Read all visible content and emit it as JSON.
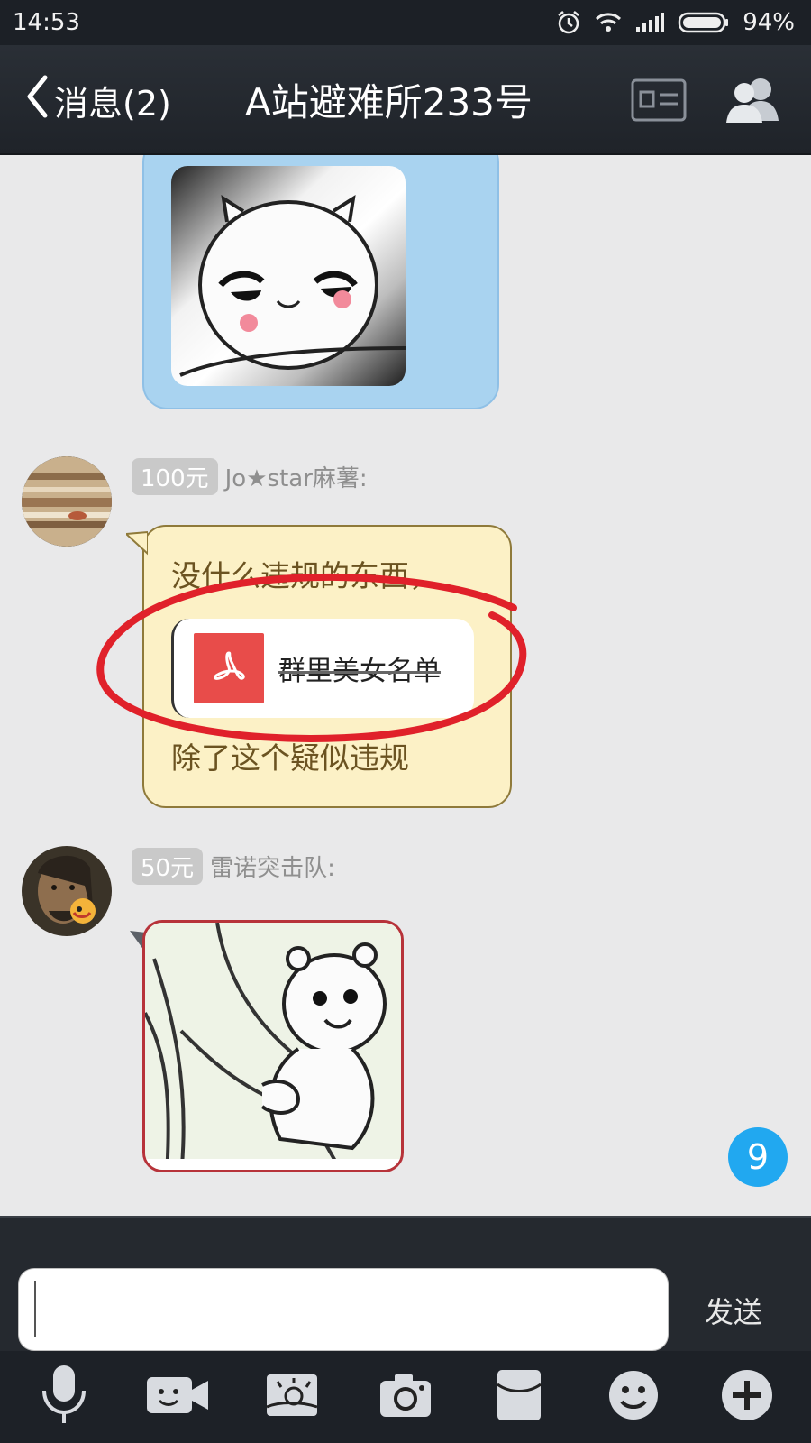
{
  "status_bar": {
    "time": "14:53",
    "battery": "94%",
    "icons": [
      "alarm-icon",
      "wifi-icon",
      "signal-icon",
      "battery-icon"
    ]
  },
  "header": {
    "back_label": "消息(2)",
    "title": "A站避难所233号",
    "icons": [
      "profile-card-icon",
      "group-members-icon"
    ]
  },
  "messages": [
    {
      "type": "sticker",
      "bubble_color": "#a9d3f0"
    },
    {
      "type": "text_with_file",
      "badge": "100元",
      "sender": "Jo★star麻薯:",
      "line1": "没什么违规的东西，",
      "file_name": "群里美女名单",
      "line2": "除了这个疑似违规",
      "bubble_color": "#fcf1c6",
      "annotation": "red-circle-around-file"
    },
    {
      "type": "sticker",
      "badge": "50元",
      "sender": "雷诺突击队:",
      "bubble_border_color": "#b7333a"
    }
  ],
  "unread_count": "9",
  "input": {
    "value": "",
    "placeholder": "",
    "send_label": "发送"
  },
  "toolbar": {
    "icons": [
      "microphone-icon",
      "video-call-icon",
      "image-icon",
      "camera-icon",
      "red-packet-icon",
      "emoji-icon",
      "plus-icon"
    ]
  },
  "colors": {
    "bar_dark": "#1c2026",
    "chat_background": "#e9e9ea",
    "unread_badge": "#21a8f0",
    "pdf_red": "#e84c4a",
    "annotation_red": "#e0212a"
  }
}
